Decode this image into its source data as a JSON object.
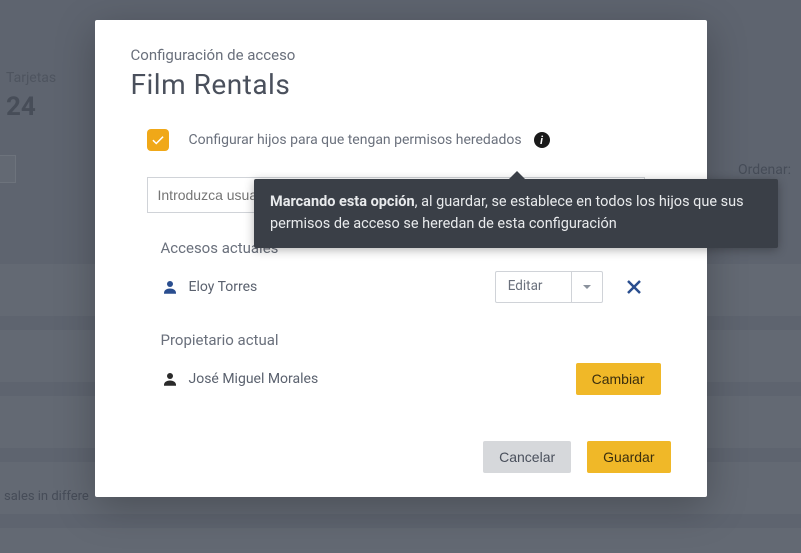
{
  "background": {
    "tarjetas_label": "Tarjetas",
    "count": "24",
    "ordenar_label": "Ordenar:",
    "sales_text": "sales in differe"
  },
  "modal": {
    "subtitle": "Configuración de acceso",
    "title": "Film Rentals",
    "checkbox_label": "Configurar hijos para que tengan permisos heredados",
    "info_glyph": "i",
    "user_input_placeholder": "Introduzca usuari",
    "accesos_label": "Accesos actuales",
    "access_user": "Eloy Torres",
    "select_value": "Editar",
    "owner_label": "Propietario actual",
    "owner_user": "José Miguel Morales",
    "cambiar_label": "Cambiar",
    "cancelar_label": "Cancelar",
    "guardar_label": "Guardar"
  },
  "tooltip": {
    "bold": "Marcando esta opción",
    "rest": ", al guardar, se establece en todos los hijos que sus permisos de acceso se heredan de esta configuración"
  }
}
